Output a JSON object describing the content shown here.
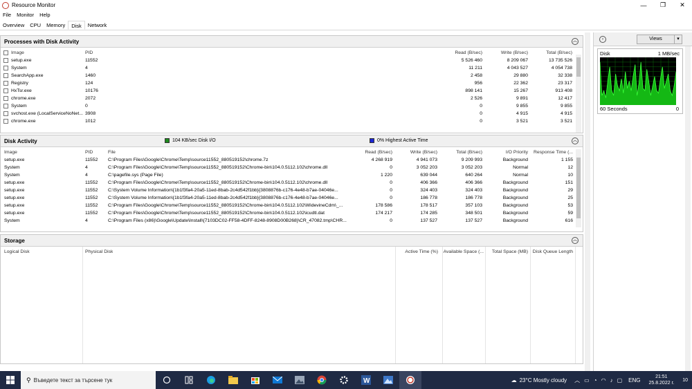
{
  "window": {
    "title": "Resource Monitor",
    "minimize": "—",
    "maximize": "❐",
    "close": "✕"
  },
  "menu": [
    "File",
    "Monitor",
    "Help"
  ],
  "tabs": [
    "Overview",
    "CPU",
    "Memory",
    "Disk",
    "Network"
  ],
  "active_tab": "Disk",
  "processes": {
    "title": "Processes with Disk Activity",
    "headers": {
      "image": "Image",
      "pid": "PID",
      "read": "Read (B/sec)",
      "write": "Write (B/sec)",
      "total": "Total (B/sec)"
    },
    "rows": [
      {
        "image": "setup.exe",
        "pid": "11552",
        "read": "5 526 460",
        "write": "8 209 067",
        "total": "13 735 526"
      },
      {
        "image": "System",
        "pid": "4",
        "read": "11 211",
        "write": "4 043 527",
        "total": "4 054 738"
      },
      {
        "image": "SearchApp.exe",
        "pid": "1460",
        "read": "2 458",
        "write": "29 880",
        "total": "32 338"
      },
      {
        "image": "Registry",
        "pid": "124",
        "read": "956",
        "write": "22 362",
        "total": "23 317"
      },
      {
        "image": "HxTsr.exe",
        "pid": "10176",
        "read": "898 141",
        "write": "15 267",
        "total": "913 408"
      },
      {
        "image": "chrome.exe",
        "pid": "2072",
        "read": "2 526",
        "write": "9 891",
        "total": "12 417"
      },
      {
        "image": "System",
        "pid": "0",
        "read": "0",
        "write": "9 855",
        "total": "9 855"
      },
      {
        "image": "svchost.exe (LocalServiceNoNet...",
        "pid": "3908",
        "read": "0",
        "write": "4 915",
        "total": "4 915"
      },
      {
        "image": "chrome.exe",
        "pid": "1012",
        "read": "0",
        "write": "3 521",
        "total": "3 521"
      }
    ]
  },
  "disk_activity": {
    "title": "Disk Activity",
    "legend_io": "104 KB/sec Disk I/O",
    "legend_active": "0% Highest Active Time",
    "headers": {
      "image": "Image",
      "pid": "PID",
      "file": "File",
      "read": "Read (B/sec)",
      "write": "Write (B/sec)",
      "total": "Total (B/sec)",
      "priority": "I/O Priority",
      "response": "Response Time (..."
    },
    "rows": [
      {
        "image": "setup.exe",
        "pid": "11552",
        "file": "C:\\Program Files\\Google\\Chrome\\Temp\\source11552_880519152\\chrome.7z",
        "read": "4 268 919",
        "write": "4 941 073",
        "total": "9 209 993",
        "priority": "Background",
        "response": "1 155"
      },
      {
        "image": "System",
        "pid": "4",
        "file": "C:\\Program Files\\Google\\Chrome\\Temp\\source11552_880519152\\Chrome-bin\\104.0.5112.102\\chrome.dll",
        "read": "0",
        "write": "3 052 203",
        "total": "3 052 203",
        "priority": "Normal",
        "response": "12"
      },
      {
        "image": "System",
        "pid": "4",
        "file": "C:\\pagefile.sys (Page File)",
        "read": "1 220",
        "write": "639 044",
        "total": "640 264",
        "priority": "Normal",
        "response": "10"
      },
      {
        "image": "setup.exe",
        "pid": "11552",
        "file": "C:\\Program Files\\Google\\Chrome\\Temp\\source11552_880519152\\Chrome-bin\\104.0.5112.102\\chrome.dll",
        "read": "0",
        "write": "406 366",
        "total": "406 366",
        "priority": "Background",
        "response": "151"
      },
      {
        "image": "setup.exe",
        "pid": "11552",
        "file": "C:\\System Volume Information\\{1b1f3fa4-20a5-11ed-8bab-2c4d542f1bb}{3808876b-c176-4e48-b7ae-04046e...",
        "read": "0",
        "write": "324 403",
        "total": "324 403",
        "priority": "Background",
        "response": "29"
      },
      {
        "image": "setup.exe",
        "pid": "11552",
        "file": "C:\\System Volume Information\\{1b1f3fa4-20a5-11ed-8bab-2c4d542f1bb}{3808876b-c176-4e48-b7ae-04046e...",
        "read": "0",
        "write": "186 778",
        "total": "186 778",
        "priority": "Background",
        "response": "25"
      },
      {
        "image": "setup.exe",
        "pid": "11552",
        "file": "C:\\Program Files\\Google\\Chrome\\Temp\\source11552_880519152\\Chrome-bin\\104.0.5112.102\\WidevineCdm\\_...",
        "read": "178 586",
        "write": "178 517",
        "total": "357 103",
        "priority": "Background",
        "response": "53"
      },
      {
        "image": "setup.exe",
        "pid": "11552",
        "file": "C:\\Program Files\\Google\\Chrome\\Temp\\source11552_880519152\\Chrome-bin\\104.0.5112.102\\icudtl.dat",
        "read": "174 217",
        "write": "174 285",
        "total": "348 501",
        "priority": "Background",
        "response": "59"
      },
      {
        "image": "System",
        "pid": "4",
        "file": "C:\\Program Files (x86)\\Google\\Update\\Install\\{7103DC02-FF58-4DFF-8248-8908D00B268}\\CR_47082.tmp\\CHR...",
        "read": "0",
        "write": "137 527",
        "total": "137 527",
        "priority": "Background",
        "response": "616"
      }
    ]
  },
  "storage": {
    "title": "Storage",
    "headers": {
      "logical": "Logical Disk",
      "physical": "Physical Disk",
      "active": "Active Time (%)",
      "available": "Available Space (...",
      "total_space": "Total Space (MB)",
      "queue": "Disk Queue Length"
    }
  },
  "right_panel": {
    "views_label": "Views",
    "graph_title": "Disk",
    "graph_scale": "1 MB/sec",
    "graph_time": "60 Seconds",
    "graph_min": "0",
    "graph_values": [
      0.9,
      0.2,
      0.3,
      0.15,
      0.5,
      0.8,
      0.3,
      0.2,
      0.65,
      0.4,
      0.3,
      0.55,
      0.25,
      0.7,
      0.35,
      0.5,
      0.3,
      0.6,
      0.85,
      0.2,
      0.45,
      0.9,
      0.35,
      0.3,
      0.75,
      0.5,
      0.2,
      0.4,
      0.6,
      0.3,
      0.25,
      0.55,
      0.8,
      0.35,
      0.5,
      0.65,
      0.3,
      0.2,
      0.4,
      0.7
    ]
  },
  "taskbar": {
    "search_placeholder": "Въведете текст за търсене тук",
    "weather": "23°C  Mostly cloudy",
    "lang": "ENG",
    "time": "21:51",
    "date": "25.8.2022 г.",
    "notif_count": "10"
  }
}
